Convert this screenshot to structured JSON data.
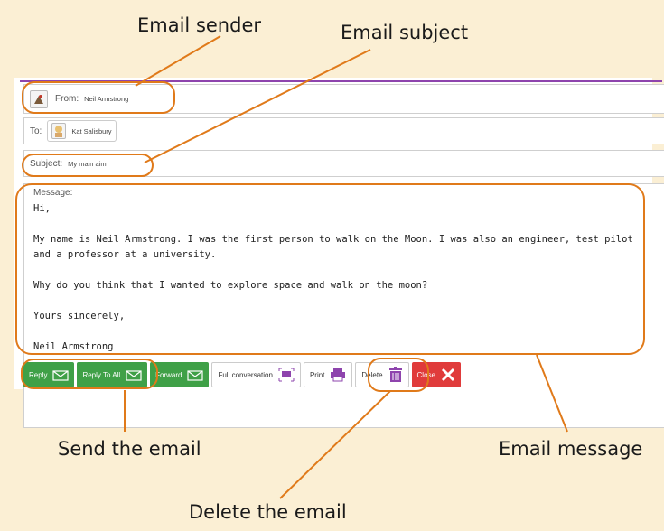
{
  "callouts": {
    "sender": "Email sender",
    "subject": "Email subject",
    "send": "Send the email",
    "message": "Email message",
    "delete": "Delete the email"
  },
  "email": {
    "from_label": "From:",
    "from_value": "Neil Armstrong",
    "to_label": "To:",
    "to_value": "Kat Salisbury",
    "subject_label": "Subject:",
    "subject_value": "My main aim",
    "message_label": "Message:",
    "message_lines": [
      "Hi,",
      "My name is Neil Armstrong. I was the first person to walk on the Moon. I was also an engineer, test pilot and a professor at a university.",
      "Why do you think that I wanted to explore space and walk on the moon?",
      "Yours sincerely,",
      "Neil Armstrong"
    ]
  },
  "buttons": {
    "reply": "Reply",
    "reply_all": "Reply To All",
    "forward": "Forward",
    "full_conversation": "Full conversation",
    "print": "Print",
    "delete": "Delete",
    "close": "Close"
  },
  "colors": {
    "accent_purple": "#8e44ad",
    "button_green": "#3fa047",
    "button_red": "#e03b3b",
    "annotation_orange": "#e07a1a",
    "background": "#fbefd4"
  }
}
